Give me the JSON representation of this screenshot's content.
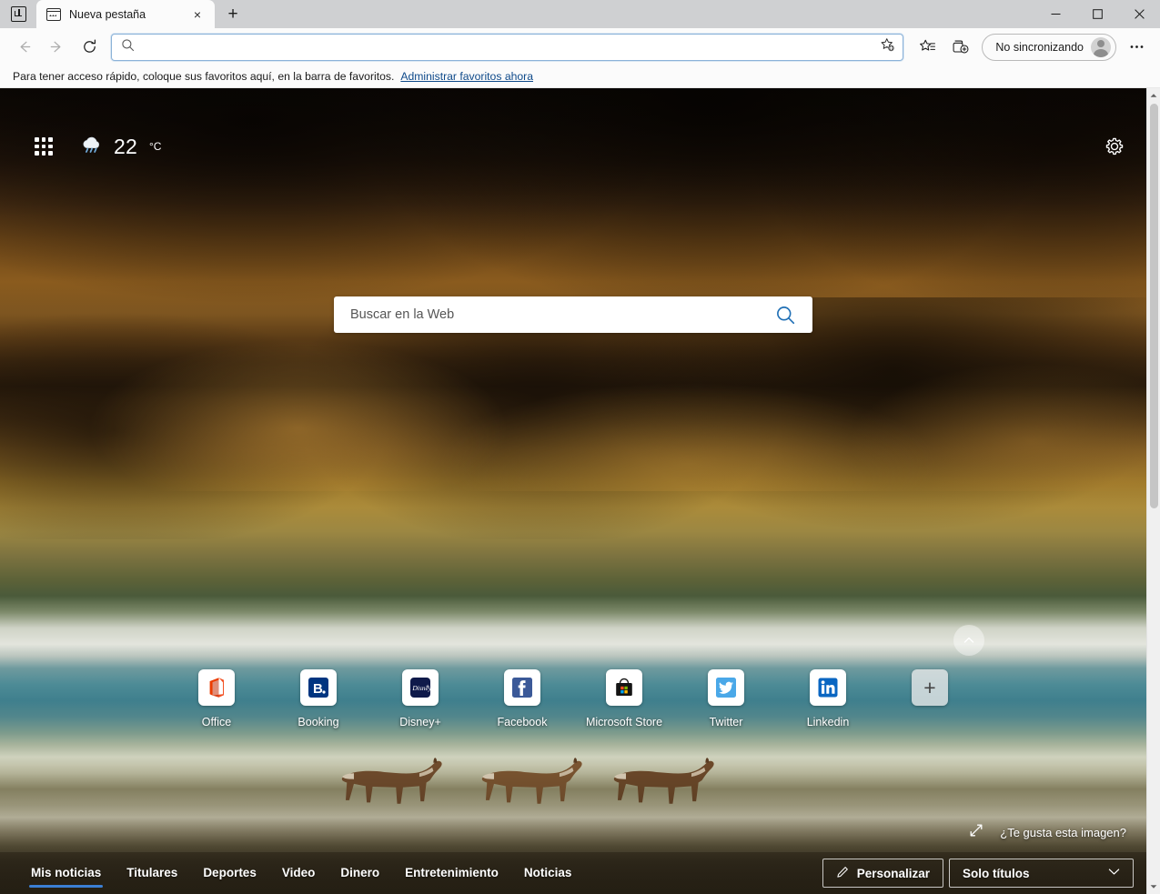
{
  "window": {
    "title": "Nueva pestaña",
    "vertical_tabs_tooltip": "Activar tabulaciones verticales",
    "minimize_label": "Minimizar",
    "maximize_label": "Maximizar",
    "close_label": "Cerrar"
  },
  "tabstrip": {
    "tabs": [
      {
        "title": "Nueva pestaña",
        "close_label": "×",
        "favicon": "new-tab-page-icon"
      }
    ],
    "new_tab_label": "+"
  },
  "toolbar": {
    "back_label": "Atrás",
    "forward_label": "Adelante",
    "refresh_label": "Actualizar",
    "address_value": "",
    "address_placeholder": "",
    "favorite_label": "Agregar esta página a favoritos",
    "favorites_hub_label": "Favoritos",
    "collections_label": "Colecciones",
    "sync_status": "No sincronizando",
    "settings_more_label": "Configuración y más"
  },
  "favorites_bar": {
    "hint": "Para tener acceso rápido, coloque sus favoritos aquí, en la barra de favoritos.",
    "link": "Administrar favoritos ahora"
  },
  "ntp": {
    "apps_label": "Aplicaciones de Microsoft 365",
    "weather": {
      "temperature": "22",
      "unit": "°C",
      "condition_icon": "rain-cloud-icon"
    },
    "settings_label": "Configuración de página",
    "search": {
      "placeholder": "Buscar en la Web",
      "value": "",
      "button_label": "Buscar"
    },
    "scroll_up_label": "Desplazarse hacia arriba",
    "like_image": {
      "expand_label": "Expandir",
      "text": "¿Te gusta esta imagen?"
    },
    "tiles": [
      {
        "label": "Office",
        "icon": "office-icon"
      },
      {
        "label": "Booking",
        "icon": "booking-icon"
      },
      {
        "label": "Disney+",
        "icon": "disney-plus-icon"
      },
      {
        "label": "Facebook",
        "icon": "facebook-icon"
      },
      {
        "label": "Microsoft Store",
        "icon": "microsoft-store-icon"
      },
      {
        "label": "Twitter",
        "icon": "twitter-icon"
      },
      {
        "label": "Linkedin",
        "icon": "linkedin-icon"
      }
    ],
    "add_tile_label": "+"
  },
  "newsbar": {
    "tabs": [
      {
        "label": "Mis noticias",
        "active": true
      },
      {
        "label": "Titulares",
        "active": false
      },
      {
        "label": "Deportes",
        "active": false
      },
      {
        "label": "Video",
        "active": false
      },
      {
        "label": "Dinero",
        "active": false
      },
      {
        "label": "Entretenimiento",
        "active": false
      },
      {
        "label": "Noticias",
        "active": false
      }
    ],
    "customize_label": "Personalizar",
    "layout_value": "Solo títulos"
  },
  "colors": {
    "accent_blue": "#3b7fd4",
    "chrome_bg": "#fbfbfb",
    "titlebar_bg": "#cfd0d2",
    "link": "#0f4a8a",
    "omnibox_focus_border": "#8bb2d8"
  }
}
